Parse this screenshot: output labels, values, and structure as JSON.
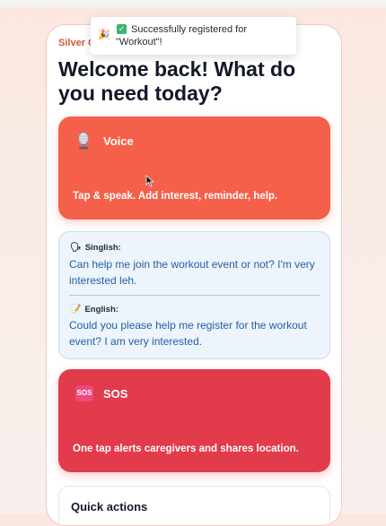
{
  "app": {
    "brand": "Silver C"
  },
  "toast": {
    "check_symbol": "✓",
    "message": "Successfully registered for \"Workout\"!"
  },
  "home": {
    "heading": "Welcome back! What do you need today?"
  },
  "voice_card": {
    "title": "Voice",
    "description": "Tap & speak. Add interest, reminder, help.",
    "icon": "microphone-icon",
    "color": "#f4604a"
  },
  "translation": {
    "singlish_label": "Singlish:",
    "singlish_text": "Can help me join the workout event or not? I'm very interested leh.",
    "english_label": "English:",
    "english_text": "Could you please help me register for the workout event? I am very interested."
  },
  "sos_card": {
    "title": "SOS",
    "badge": "SOS",
    "description": "One tap alerts caregivers and shares location.",
    "color": "#e23b4b"
  },
  "quick_actions": {
    "title": "Quick actions"
  }
}
